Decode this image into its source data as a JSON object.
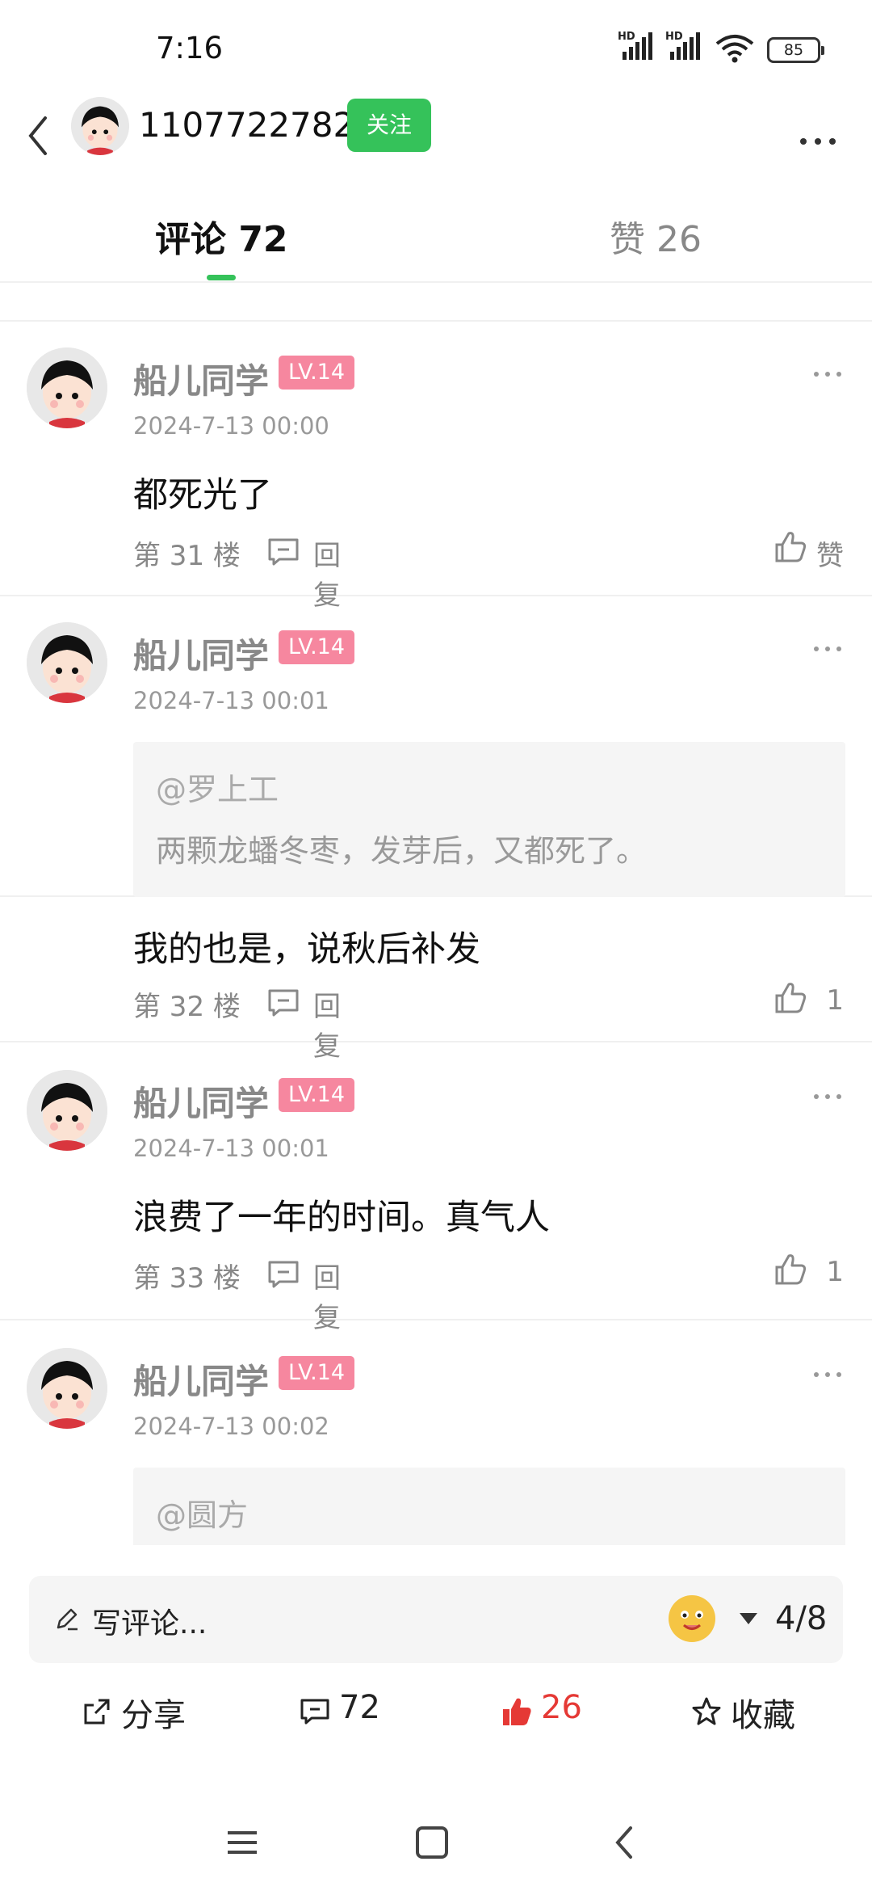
{
  "status_bar": {
    "time": "7:16",
    "signal_1_label": "HD",
    "signal_2_label": "HD",
    "battery": "85"
  },
  "header": {
    "user_id": "1107722782",
    "follow_label": "关注"
  },
  "tabs": {
    "comments_label": "评论 72",
    "likes_label": "赞 26",
    "active_color": "#35c25a"
  },
  "comments": [
    {
      "name": "船儿同学",
      "level": "LV.14",
      "date": "2024-7-13 00:00",
      "text": "都死光了",
      "floor": "第 31 楼",
      "reply_label": "回复",
      "like_label": "赞"
    },
    {
      "name": "船儿同学",
      "level": "LV.14",
      "date": "2024-7-13 00:01",
      "quote_user": "@罗上工",
      "quote_text": "两颗龙蟠冬枣，发芽后，又都死了。",
      "text": "我的也是，说秋后补发",
      "floor": "第 32 楼",
      "reply_label": "回复",
      "like_label": "1"
    },
    {
      "name": "船儿同学",
      "level": "LV.14",
      "date": "2024-7-13 00:01",
      "text": "浪费了一年的时间。真气人",
      "floor": "第 33 楼",
      "reply_label": "回复",
      "like_label": "1"
    },
    {
      "name": "船儿同学",
      "level": "LV.14",
      "date": "2024-7-13 00:02",
      "quote_user": "@圆方"
    }
  ],
  "composer": {
    "placeholder": "写评论...",
    "page_indicator": "4/8"
  },
  "actions": {
    "share_label": "分享",
    "comments_count": "72",
    "likes_count": "26",
    "favorite_label": "收藏",
    "like_color": "#e53935"
  },
  "icons": {
    "back": "chevron-left-icon",
    "more": "more-dots-icon",
    "reply": "comment-bubble-icon",
    "like": "thumbs-up-icon",
    "share": "share-icon",
    "favorite": "star-icon"
  }
}
